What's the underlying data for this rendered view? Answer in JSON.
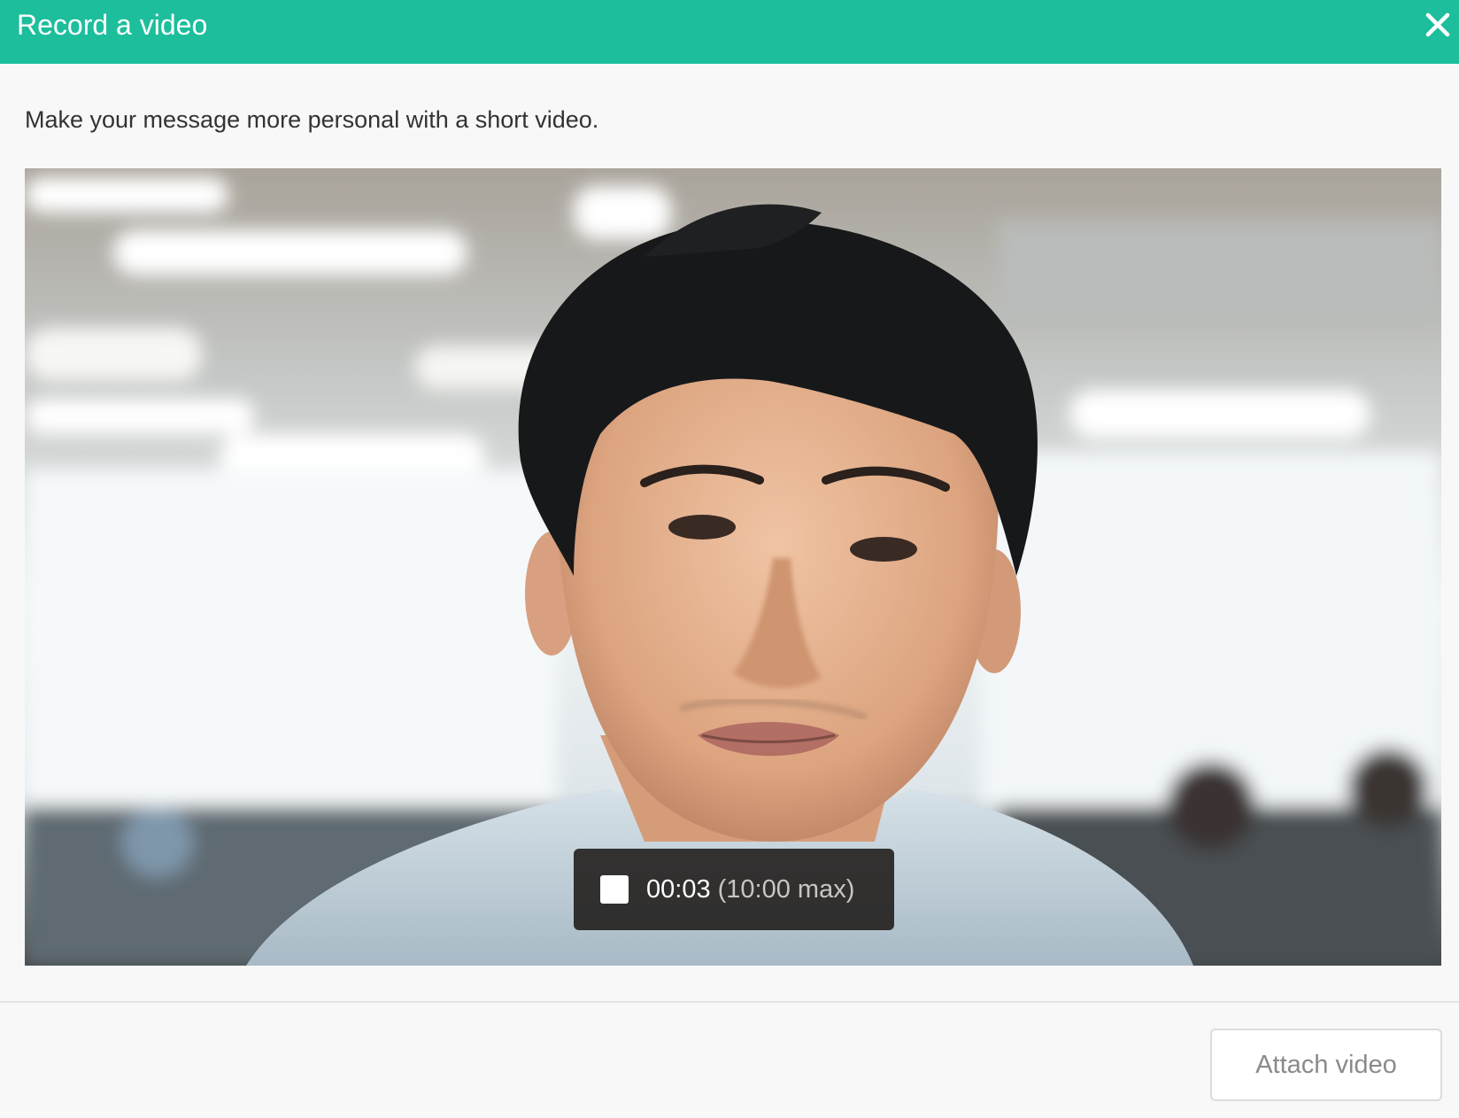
{
  "dialog": {
    "title": "Record a video",
    "close_icon": "close-icon",
    "description": "Make your message more personal with a short video."
  },
  "video_preview": {
    "recording": {
      "stop_icon": "stop-icon",
      "elapsed": "00:03",
      "max_label": "(10:00 max)"
    }
  },
  "footer": {
    "attach_label": "Attach video",
    "attach_enabled": false
  },
  "colors": {
    "header": "#1dbe9c",
    "background": "#f8f8f8",
    "recording_bar": "#1e1a18"
  }
}
